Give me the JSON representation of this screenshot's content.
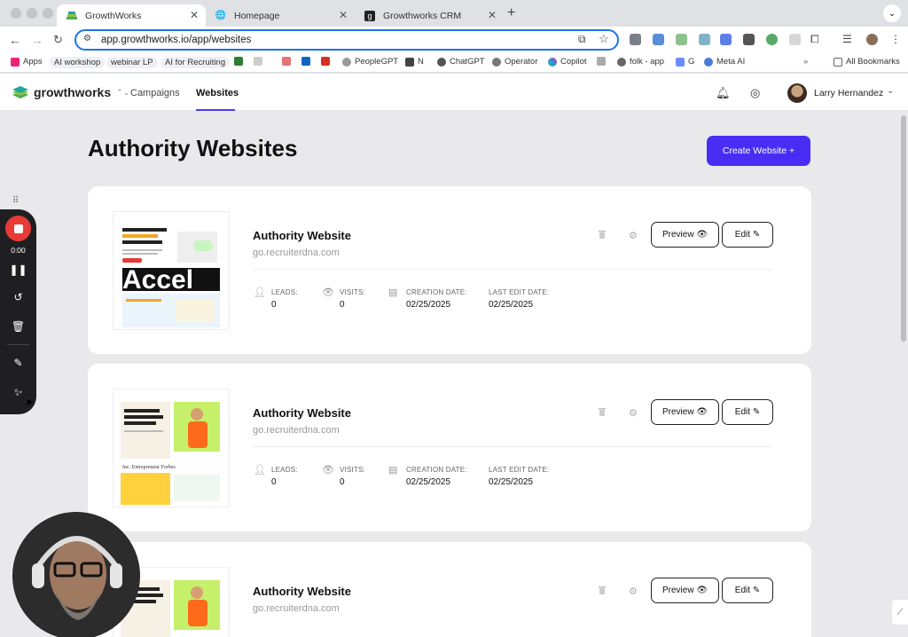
{
  "browser": {
    "tabs": [
      {
        "label": "GrowthWorks",
        "active": true,
        "icon": "growthworks-icon"
      },
      {
        "label": "Homepage",
        "active": false,
        "icon": "globe-icon"
      },
      {
        "label": "Growthworks CRM",
        "active": false,
        "icon": "g-icon"
      }
    ],
    "url": "app.growthworks.io/app/websites",
    "bookmarks": [
      "Apps",
      "AI workshop",
      "webinar LP",
      "AI for Recruiting",
      "PeopleGPT",
      "N",
      "ChatGPT",
      "Operator",
      "Copilot",
      "folk - app",
      "G",
      "Meta AI",
      "All Bookmarks"
    ]
  },
  "app": {
    "brand": "growthworks",
    "nav": {
      "campaigns": "Campaigns",
      "websites": "Websites"
    },
    "user": "Larry Hernandez"
  },
  "page": {
    "title": "Authority Websites",
    "create_label": "Create Website +"
  },
  "cards": [
    {
      "title": "Authority Website",
      "domain": "go.recruiterdna.com",
      "preview": "Preview",
      "edit": "Edit",
      "stats": {
        "leads_label": "LEADS:",
        "leads": "0",
        "visits_label": "VISITS:",
        "visits": "0",
        "created_label": "CREATION DATE:",
        "created": "02/25/2025",
        "edited_label": "LAST EDIT DATE:",
        "edited": "02/25/2025"
      }
    },
    {
      "title": "Authority Website",
      "domain": "go.recruiterdna.com",
      "preview": "Preview",
      "edit": "Edit",
      "stats": {
        "leads_label": "LEADS:",
        "leads": "0",
        "visits_label": "VISITS:",
        "visits": "0",
        "created_label": "CREATION DATE:",
        "created": "02/25/2025",
        "edited_label": "LAST EDIT DATE:",
        "edited": "02/25/2025"
      }
    },
    {
      "title": "Authority Website",
      "domain": "go.recruiterdna.com",
      "preview": "Preview",
      "edit": "Edit"
    }
  ],
  "recorder": {
    "time": "0:00"
  },
  "colors": {
    "accent": "#4a2df5",
    "record": "#e83b36"
  }
}
